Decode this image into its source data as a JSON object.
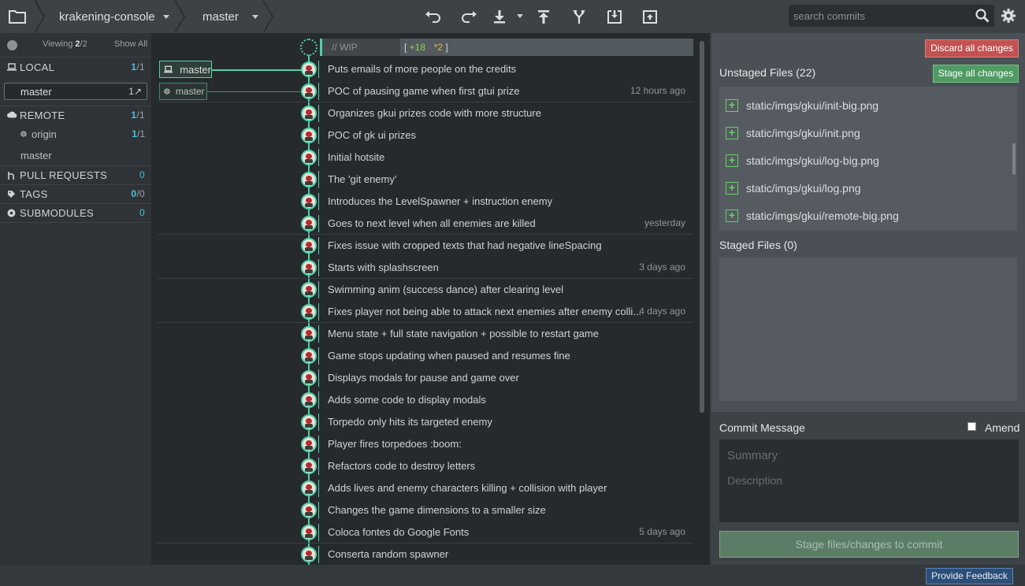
{
  "toolbar": {
    "repo_name": "krakening-console",
    "branch_name": "master",
    "search_placeholder": "search commits",
    "icons": [
      "folder-icon",
      "undo-icon",
      "redo-icon",
      "pull-icon",
      "push-icon",
      "branch-icon",
      "stash-icon",
      "pop-icon",
      "search-icon",
      "gear-icon"
    ]
  },
  "sidebar": {
    "viewing_prefix": "Viewing ",
    "viewing_count": "2",
    "viewing_total": "/2",
    "show_all": "Show All",
    "local": {
      "label": "LOCAL",
      "count": "1",
      "total": "/1"
    },
    "local_branch": {
      "name": "master",
      "count": "1↗"
    },
    "remote": {
      "label": "REMOTE",
      "count": "1",
      "total": "/1"
    },
    "remote_origin": {
      "name": "origin",
      "count": "1",
      "total": "/1"
    },
    "remote_branch": {
      "name": "master"
    },
    "pull_requests": {
      "label": "PULL REQUESTS",
      "count": "0"
    },
    "tags": {
      "label": "TAGS",
      "count": "0",
      "total": "/0"
    },
    "submodules": {
      "label": "SUBMODULES",
      "count": "0"
    }
  },
  "graph": {
    "wip_label": "// WIP",
    "wip_add": "+18",
    "wip_del": "-",
    "wip_mod": "*2",
    "local_branch_tag": "master",
    "remote_branch_tag": "master",
    "commits": [
      {
        "message": "Puts emails of more people on the credits",
        "time": "",
        "divider": false
      },
      {
        "message": "POC of pausing game when first gtui prize",
        "time": "12 hours ago",
        "divider": true
      },
      {
        "message": "Organizes gkui prizes code with more structure",
        "time": "",
        "divider": false
      },
      {
        "message": "POC of gk ui prizes",
        "time": "",
        "divider": false
      },
      {
        "message": "Initial hotsite",
        "time": "",
        "divider": false
      },
      {
        "message": "The 'git enemy'",
        "time": "",
        "divider": false
      },
      {
        "message": "Introduces the LevelSpawner + instruction enemy",
        "time": "",
        "divider": false
      },
      {
        "message": "Goes to next level when all enemies are killed",
        "time": "yesterday",
        "divider": true
      },
      {
        "message": "Fixes issue with cropped texts that had negative lineSpacing",
        "time": "",
        "divider": false
      },
      {
        "message": "Starts with splashscreen",
        "time": "3 days ago",
        "divider": true
      },
      {
        "message": "Swimming anim (success dance) after clearing level",
        "time": "",
        "divider": false
      },
      {
        "message": "Fixes player not being able to attack next enemies after enemy colli...",
        "time": "4 days ago",
        "divider": true
      },
      {
        "message": "Menu state + full state navigation + possible to restart game",
        "time": "",
        "divider": false
      },
      {
        "message": "Game stops updating when paused and resumes fine",
        "time": "",
        "divider": false
      },
      {
        "message": "Displays modals for pause and game over",
        "time": "",
        "divider": false
      },
      {
        "message": "Adds some code to display modals",
        "time": "",
        "divider": false
      },
      {
        "message": "Torpedo only hits its targeted enemy",
        "time": "",
        "divider": false
      },
      {
        "message": "Player fires torpedoes :boom:",
        "time": "",
        "divider": false
      },
      {
        "message": "Refactors code to destroy letters",
        "time": "",
        "divider": false
      },
      {
        "message": "Adds lives and enemy characters killing + collision with player",
        "time": "",
        "divider": false
      },
      {
        "message": "Changes the game dimensions to a smaller size",
        "time": "",
        "divider": false
      },
      {
        "message": "Coloca fontes do Google Fonts",
        "time": "5 days ago",
        "divider": true
      },
      {
        "message": "Conserta random spawner",
        "time": "",
        "divider": false
      }
    ]
  },
  "changes": {
    "discard_label": "Discard all changes",
    "stage_all_label": "Stage all changes",
    "unstaged_title": "Unstaged Files (22)",
    "unstaged_files": [
      "static/imgs/gkui/init-big.png",
      "static/imgs/gkui/init.png",
      "static/imgs/gkui/log-big.png",
      "static/imgs/gkui/log.png",
      "static/imgs/gkui/remote-big.png"
    ],
    "staged_title": "Staged Files (0)",
    "commit_title": "Commit Message",
    "amend_label": "Amend",
    "summary_placeholder": "Summary",
    "description_placeholder": "Description",
    "stage_button": "Stage files/changes to commit"
  },
  "statusbar": {
    "feedback_label": "Provide Feedback"
  },
  "colors": {
    "accent": "#4fd1a5",
    "discard": "#c35252",
    "stage": "#4f9b63",
    "feedback": "#2c4f7a"
  }
}
